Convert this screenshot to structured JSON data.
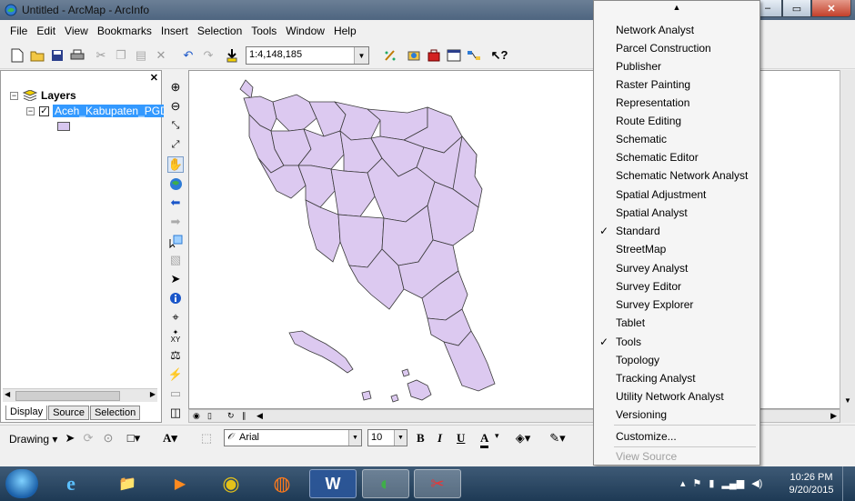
{
  "window": {
    "title": "Untitled - ArcMap - ArcInfo",
    "min_label": "–",
    "max_label": "▭",
    "close_label": "✕"
  },
  "menubar": [
    {
      "label": "File"
    },
    {
      "label": "Edit"
    },
    {
      "label": "View"
    },
    {
      "label": "Bookmarks"
    },
    {
      "label": "Insert"
    },
    {
      "label": "Selection"
    },
    {
      "label": "Tools"
    },
    {
      "label": "Window"
    },
    {
      "label": "Help"
    }
  ],
  "toolbar": {
    "scale": "1:4,148,185"
  },
  "toc": {
    "root_label": "Layers",
    "layer_name": "Aceh_Kabupaten_PGD",
    "tabs": [
      "Display",
      "Source",
      "Selection"
    ],
    "swatch_color": "#d7c6ef"
  },
  "drawing": {
    "label": "Drawing",
    "font": "Arial",
    "font_size": "10",
    "bold": "B",
    "italic": "I",
    "underline": "U",
    "font_color_glyph": "A"
  },
  "toolbar_menu": {
    "items": [
      {
        "label": "Network Analyst",
        "checked": false
      },
      {
        "label": "Parcel Construction",
        "checked": false
      },
      {
        "label": "Publisher",
        "checked": false
      },
      {
        "label": "Raster Painting",
        "checked": false
      },
      {
        "label": "Representation",
        "checked": false
      },
      {
        "label": "Route Editing",
        "checked": false
      },
      {
        "label": "Schematic",
        "checked": false
      },
      {
        "label": "Schematic Editor",
        "checked": false
      },
      {
        "label": "Schematic Network Analyst",
        "checked": false
      },
      {
        "label": "Spatial Adjustment",
        "checked": false
      },
      {
        "label": "Spatial Analyst",
        "checked": false
      },
      {
        "label": "Standard",
        "checked": true
      },
      {
        "label": "StreetMap",
        "checked": false
      },
      {
        "label": "Survey Analyst",
        "checked": false
      },
      {
        "label": "Survey Editor",
        "checked": false
      },
      {
        "label": "Survey Explorer",
        "checked": false
      },
      {
        "label": "Tablet",
        "checked": false
      },
      {
        "label": "Tools",
        "checked": true
      },
      {
        "label": "Topology",
        "checked": false
      },
      {
        "label": "Tracking Analyst",
        "checked": false
      },
      {
        "label": "Utility Network Analyst",
        "checked": false
      },
      {
        "label": "Versioning",
        "checked": false
      }
    ],
    "customize": "Customize...",
    "view_source": "View Source"
  },
  "map": {
    "fill_color": "#dcc9f0",
    "stroke_color": "#3a3a3a"
  },
  "taskbar": {
    "apps": [
      {
        "icon": "internet-explorer-icon",
        "glyph": "e"
      },
      {
        "icon": "file-explorer-icon",
        "glyph": "📁"
      },
      {
        "icon": "media-player-icon",
        "glyph": "▶"
      },
      {
        "icon": "chrome-icon",
        "glyph": "◉"
      },
      {
        "icon": "firefox-icon",
        "glyph": "◍"
      },
      {
        "icon": "word-icon",
        "glyph": "W"
      },
      {
        "icon": "arcmap-icon",
        "glyph": "◐"
      },
      {
        "icon": "arccatalog-icon",
        "glyph": "✂"
      }
    ],
    "time": "10:26 PM",
    "date": "9/20/2015"
  }
}
